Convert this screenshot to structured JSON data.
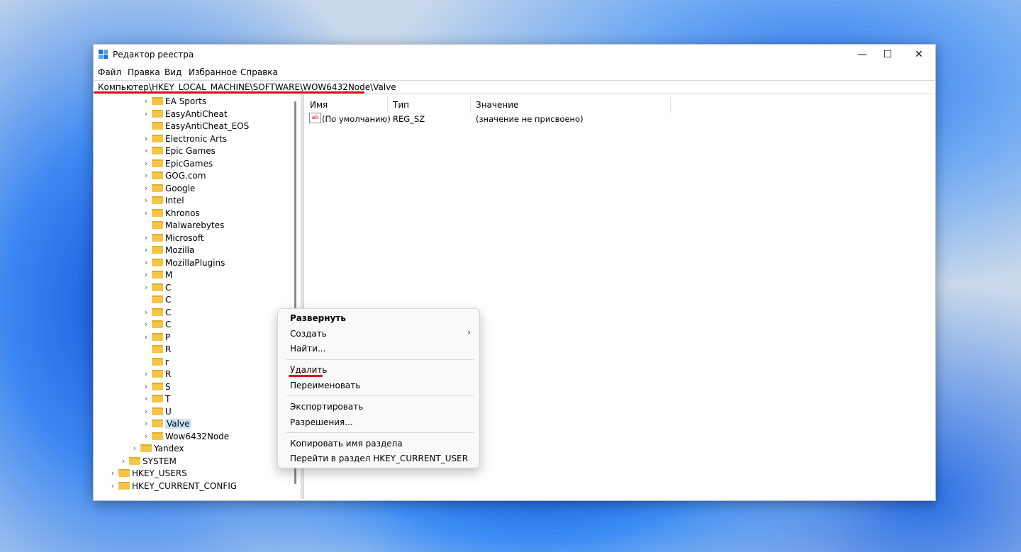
{
  "window": {
    "title": "Редактор реестра",
    "controls": {
      "minimize": "—",
      "maximize": "☐",
      "close": "✕"
    }
  },
  "menu": [
    "Файл",
    "Правка",
    "Вид",
    "Избранное",
    "Справка"
  ],
  "address": "Компьютер\\HKEY_LOCAL_MACHINE\\SOFTWARE\\WOW6432Node\\Valve",
  "tree": {
    "items": [
      "EA Sports",
      "EasyAntiCheat",
      "EasyAntiCheat_EOS",
      "Electronic Arts",
      "Epic Games",
      "EpicGames",
      "GOG.com",
      "Google",
      "Intel",
      "Khronos",
      "Malwarebytes",
      "Microsoft",
      "Mozilla",
      "MozillaPlugins",
      "M",
      "C",
      "C",
      "C",
      "C",
      "P",
      "R",
      "r",
      "R",
      "S",
      "T",
      "U",
      "Valve",
      "Wow6432Node",
      "Yandex",
      "SYSTEM",
      "HKEY_USERS",
      "HKEY_CURRENT_CONFIG"
    ],
    "selected": "Valve"
  },
  "list": {
    "columns": [
      "Имя",
      "Тип",
      "Значение"
    ],
    "rows": [
      {
        "name": "(По умолчанию)",
        "type": "REG_SZ",
        "value": "(значение не присвоено)"
      }
    ]
  },
  "context_menu": {
    "items": [
      "Развернуть",
      "Создать",
      "Найти...",
      "Удалить",
      "Переименовать",
      "Экспортировать",
      "Разрешения...",
      "Копировать имя раздела",
      "Перейти в раздел HKEY_CURRENT_USER"
    ],
    "submenu_arrow": "›"
  },
  "colors": {
    "highlight_red": "#d4141c",
    "selection": "#cce4f7",
    "folder": "#f3c64a"
  }
}
